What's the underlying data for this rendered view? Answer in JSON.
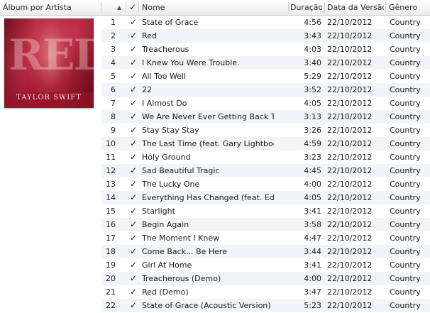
{
  "header": {
    "album_by_artist": "Álbum por Artista",
    "sort_indicator": "▲",
    "check": "✓",
    "name": "Nome",
    "duration": "Duração",
    "release_date": "Data da Versão",
    "genre": "Gênero"
  },
  "album": {
    "art_title": "RED",
    "art_artist": "TAYLOR SWIFT"
  },
  "tracks": [
    {
      "num": "1",
      "checked": "✓",
      "name": "State of Grace",
      "duration": "4:56",
      "date": "22/10/2012",
      "genre": "Country"
    },
    {
      "num": "2",
      "checked": "✓",
      "name": "Red",
      "duration": "3:43",
      "date": "22/10/2012",
      "genre": "Country"
    },
    {
      "num": "3",
      "checked": "✓",
      "name": "Treacherous",
      "duration": "4:03",
      "date": "22/10/2012",
      "genre": "Country"
    },
    {
      "num": "4",
      "checked": "✓",
      "name": "I Knew You Were Trouble.",
      "duration": "3:40",
      "date": "22/10/2012",
      "genre": "Country"
    },
    {
      "num": "5",
      "checked": "✓",
      "name": "All Too Well",
      "duration": "5:29",
      "date": "22/10/2012",
      "genre": "Country"
    },
    {
      "num": "6",
      "checked": "✓",
      "name": "22",
      "duration": "3:52",
      "date": "22/10/2012",
      "genre": "Country"
    },
    {
      "num": "7",
      "checked": "✓",
      "name": "I Almost Do",
      "duration": "4:05",
      "date": "22/10/2012",
      "genre": "Country"
    },
    {
      "num": "8",
      "checked": "✓",
      "name": "We Are Never Ever Getting Back T...",
      "duration": "3:13",
      "date": "22/10/2012",
      "genre": "Country"
    },
    {
      "num": "9",
      "checked": "✓",
      "name": "Stay Stay Stay",
      "duration": "3:26",
      "date": "22/10/2012",
      "genre": "Country"
    },
    {
      "num": "10",
      "checked": "✓",
      "name": "The Last Time (feat. Gary Lightbody)",
      "duration": "4:59",
      "date": "22/10/2012",
      "genre": "Country"
    },
    {
      "num": "11",
      "checked": "✓",
      "name": "Holy Ground",
      "duration": "3:23",
      "date": "22/10/2012",
      "genre": "Country"
    },
    {
      "num": "12",
      "checked": "✓",
      "name": "Sad Beautiful Tragic",
      "duration": "4:45",
      "date": "22/10/2012",
      "genre": "Country"
    },
    {
      "num": "13",
      "checked": "✓",
      "name": "The Lucky One",
      "duration": "4:00",
      "date": "22/10/2012",
      "genre": "Country"
    },
    {
      "num": "14",
      "checked": "✓",
      "name": "Everything Has Changed (feat. Ed ...",
      "duration": "4:05",
      "date": "22/10/2012",
      "genre": "Country"
    },
    {
      "num": "15",
      "checked": "✓",
      "name": "Starlight",
      "duration": "3:41",
      "date": "22/10/2012",
      "genre": "Country"
    },
    {
      "num": "16",
      "checked": "✓",
      "name": "Begin Again",
      "duration": "3:58",
      "date": "22/10/2012",
      "genre": "Country"
    },
    {
      "num": "17",
      "checked": "✓",
      "name": "The Moment I Knew",
      "duration": "4:47",
      "date": "22/10/2012",
      "genre": "Country"
    },
    {
      "num": "18",
      "checked": "✓",
      "name": "Come Back... Be Here",
      "duration": "3:44",
      "date": "22/10/2012",
      "genre": "Country"
    },
    {
      "num": "19",
      "checked": "✓",
      "name": "Girl At Home",
      "duration": "3:41",
      "date": "22/10/2012",
      "genre": "Country"
    },
    {
      "num": "20",
      "checked": "✓",
      "name": "Treacherous (Demo)",
      "duration": "4:00",
      "date": "22/10/2012",
      "genre": "Country"
    },
    {
      "num": "21",
      "checked": "✓",
      "name": "Red (Demo)",
      "duration": "3:47",
      "date": "22/10/2012",
      "genre": "Country"
    },
    {
      "num": "22",
      "checked": "✓",
      "name": "State of Grace (Acoustic Version)",
      "duration": "5:23",
      "date": "22/10/2012",
      "genre": "Country"
    }
  ]
}
